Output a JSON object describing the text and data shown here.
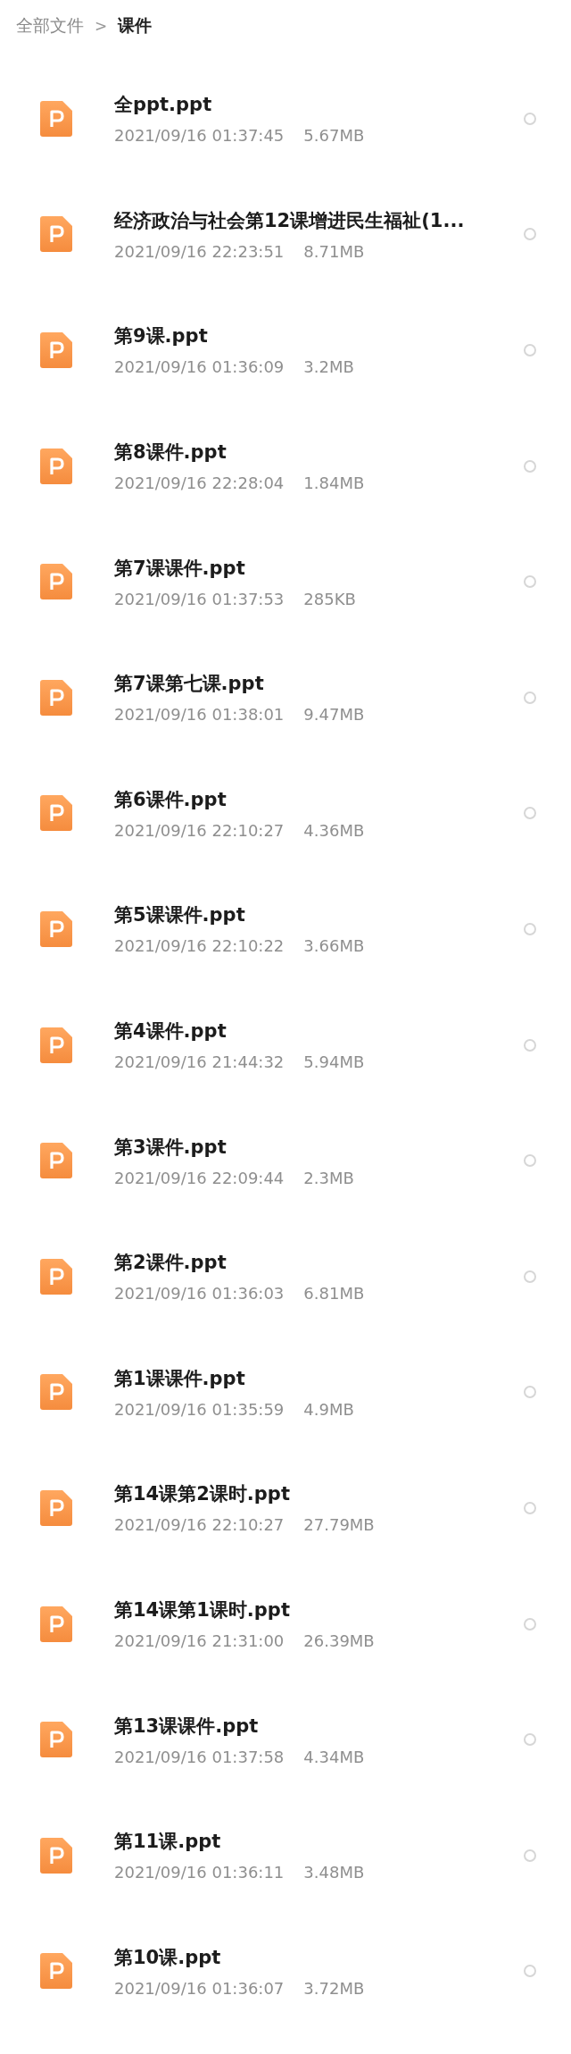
{
  "breadcrumb": [
    {
      "label": "全部文件",
      "current": false
    },
    {
      "separator": ">"
    },
    {
      "label": "课件",
      "current": true
    }
  ],
  "files": [
    {
      "name": "全ppt.ppt",
      "date": "2021/09/16 01:37:45",
      "size": "5.67MB",
      "selected": false
    },
    {
      "name": "经济政治与社会第12课增进民生福祉(1...",
      "date": "2021/09/16 22:23:51",
      "size": "8.71MB",
      "selected": false
    },
    {
      "name": "第9课.ppt",
      "date": "2021/09/16 01:36:09",
      "size": "3.2MB",
      "selected": false
    },
    {
      "name": "第8课件.ppt",
      "date": "2021/09/16 22:28:04",
      "size": "1.84MB",
      "selected": false
    },
    {
      "name": "第7课课件.ppt",
      "date": "2021/09/16 01:37:53",
      "size": "285KB",
      "selected": false
    },
    {
      "name": "第7课第七课.ppt",
      "date": "2021/09/16 01:38:01",
      "size": "9.47MB",
      "selected": false
    },
    {
      "name": "第6课件.ppt",
      "date": "2021/09/16 22:10:27",
      "size": "4.36MB",
      "selected": false
    },
    {
      "name": "第5课课件.ppt",
      "date": "2021/09/16 22:10:22",
      "size": "3.66MB",
      "selected": false
    },
    {
      "name": "第4课件.ppt",
      "date": "2021/09/16 21:44:32",
      "size": "5.94MB",
      "selected": false
    },
    {
      "name": "第3课件.ppt",
      "date": "2021/09/16 22:09:44",
      "size": "2.3MB",
      "selected": false
    },
    {
      "name": "第2课件.ppt",
      "date": "2021/09/16 01:36:03",
      "size": "6.81MB",
      "selected": false
    },
    {
      "name": "第1课课件.ppt",
      "date": "2021/09/16 01:35:59",
      "size": "4.9MB",
      "selected": false
    },
    {
      "name": "第14课第2课时.ppt",
      "date": "2021/09/16 22:10:27",
      "size": "27.79MB",
      "selected": false
    },
    {
      "name": "第14课第1课时.ppt",
      "date": "2021/09/16 21:31:00",
      "size": "26.39MB",
      "selected": false
    },
    {
      "name": "第13课课件.ppt",
      "date": "2021/09/16 01:37:58",
      "size": "4.34MB",
      "selected": false
    },
    {
      "name": "第11课.ppt",
      "date": "2021/09/16 01:36:11",
      "size": "3.48MB",
      "selected": false
    },
    {
      "name": "第10课.ppt",
      "date": "2021/09/16 01:36:07",
      "size": "3.72MB",
      "selected": false
    }
  ]
}
